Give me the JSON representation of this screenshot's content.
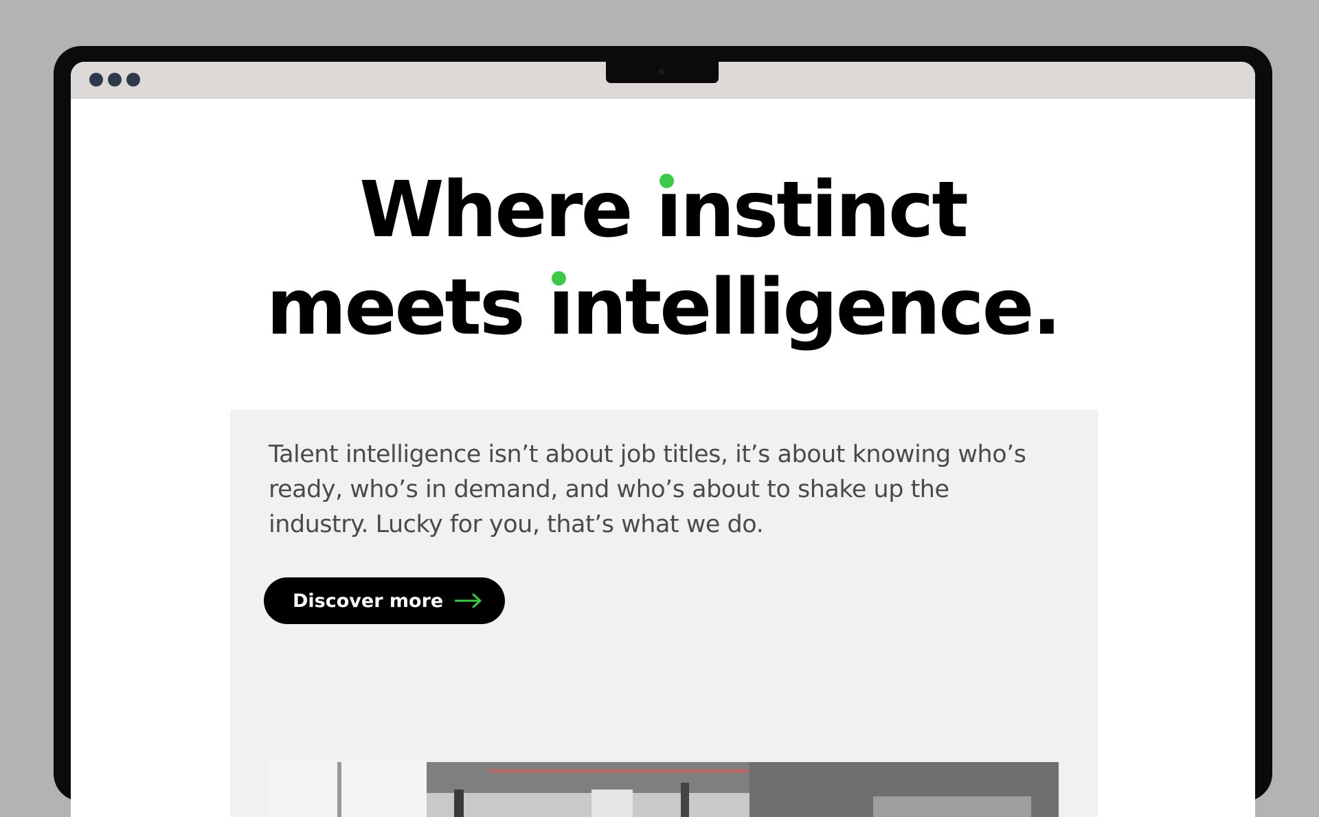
{
  "window": {
    "controls": [
      "dot",
      "dot",
      "dot"
    ]
  },
  "hero": {
    "line1_part1": "Where ",
    "line1_i": "ı",
    "line1_part2": "nstinct",
    "line2_part1": "meets ",
    "line2_i": "ı",
    "line2_part2": "ntelligence.",
    "accent_color": "#3ec84a"
  },
  "intro": {
    "text": "Talent intelligence isn’t about job titles, it’s about knowing who’s ready, who’s in demand, and who’s about to shake up the industry. Lucky for you, that’s what we do."
  },
  "cta": {
    "label": "Discover more",
    "icon": "arrow-right-icon"
  }
}
